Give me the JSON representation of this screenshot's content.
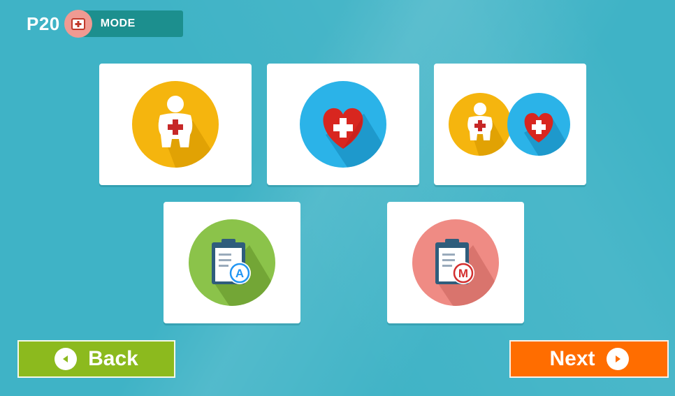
{
  "header": {
    "page_number": "P20",
    "mode_label": "MODE",
    "mode_icon": "medical-kit-icon"
  },
  "tiles": [
    {
      "icon": "person-health-icon",
      "color": "#f5b50e"
    },
    {
      "icon": "heart-health-icon",
      "color": "#2bb3e8"
    },
    {
      "icon": "person-and-heart-icon",
      "color": "#f5b50e"
    },
    {
      "icon": "clipboard-a-icon",
      "color": "#8bc34a"
    },
    {
      "icon": "clipboard-m-icon",
      "color": "#ef8b84"
    }
  ],
  "nav": {
    "back_label": "Back",
    "next_label": "Next",
    "back_color": "#8cba1e",
    "next_color": "#ff6d00"
  },
  "colors": {
    "background": "#3fb3c6",
    "mode_bar": "#1c8f8e"
  }
}
